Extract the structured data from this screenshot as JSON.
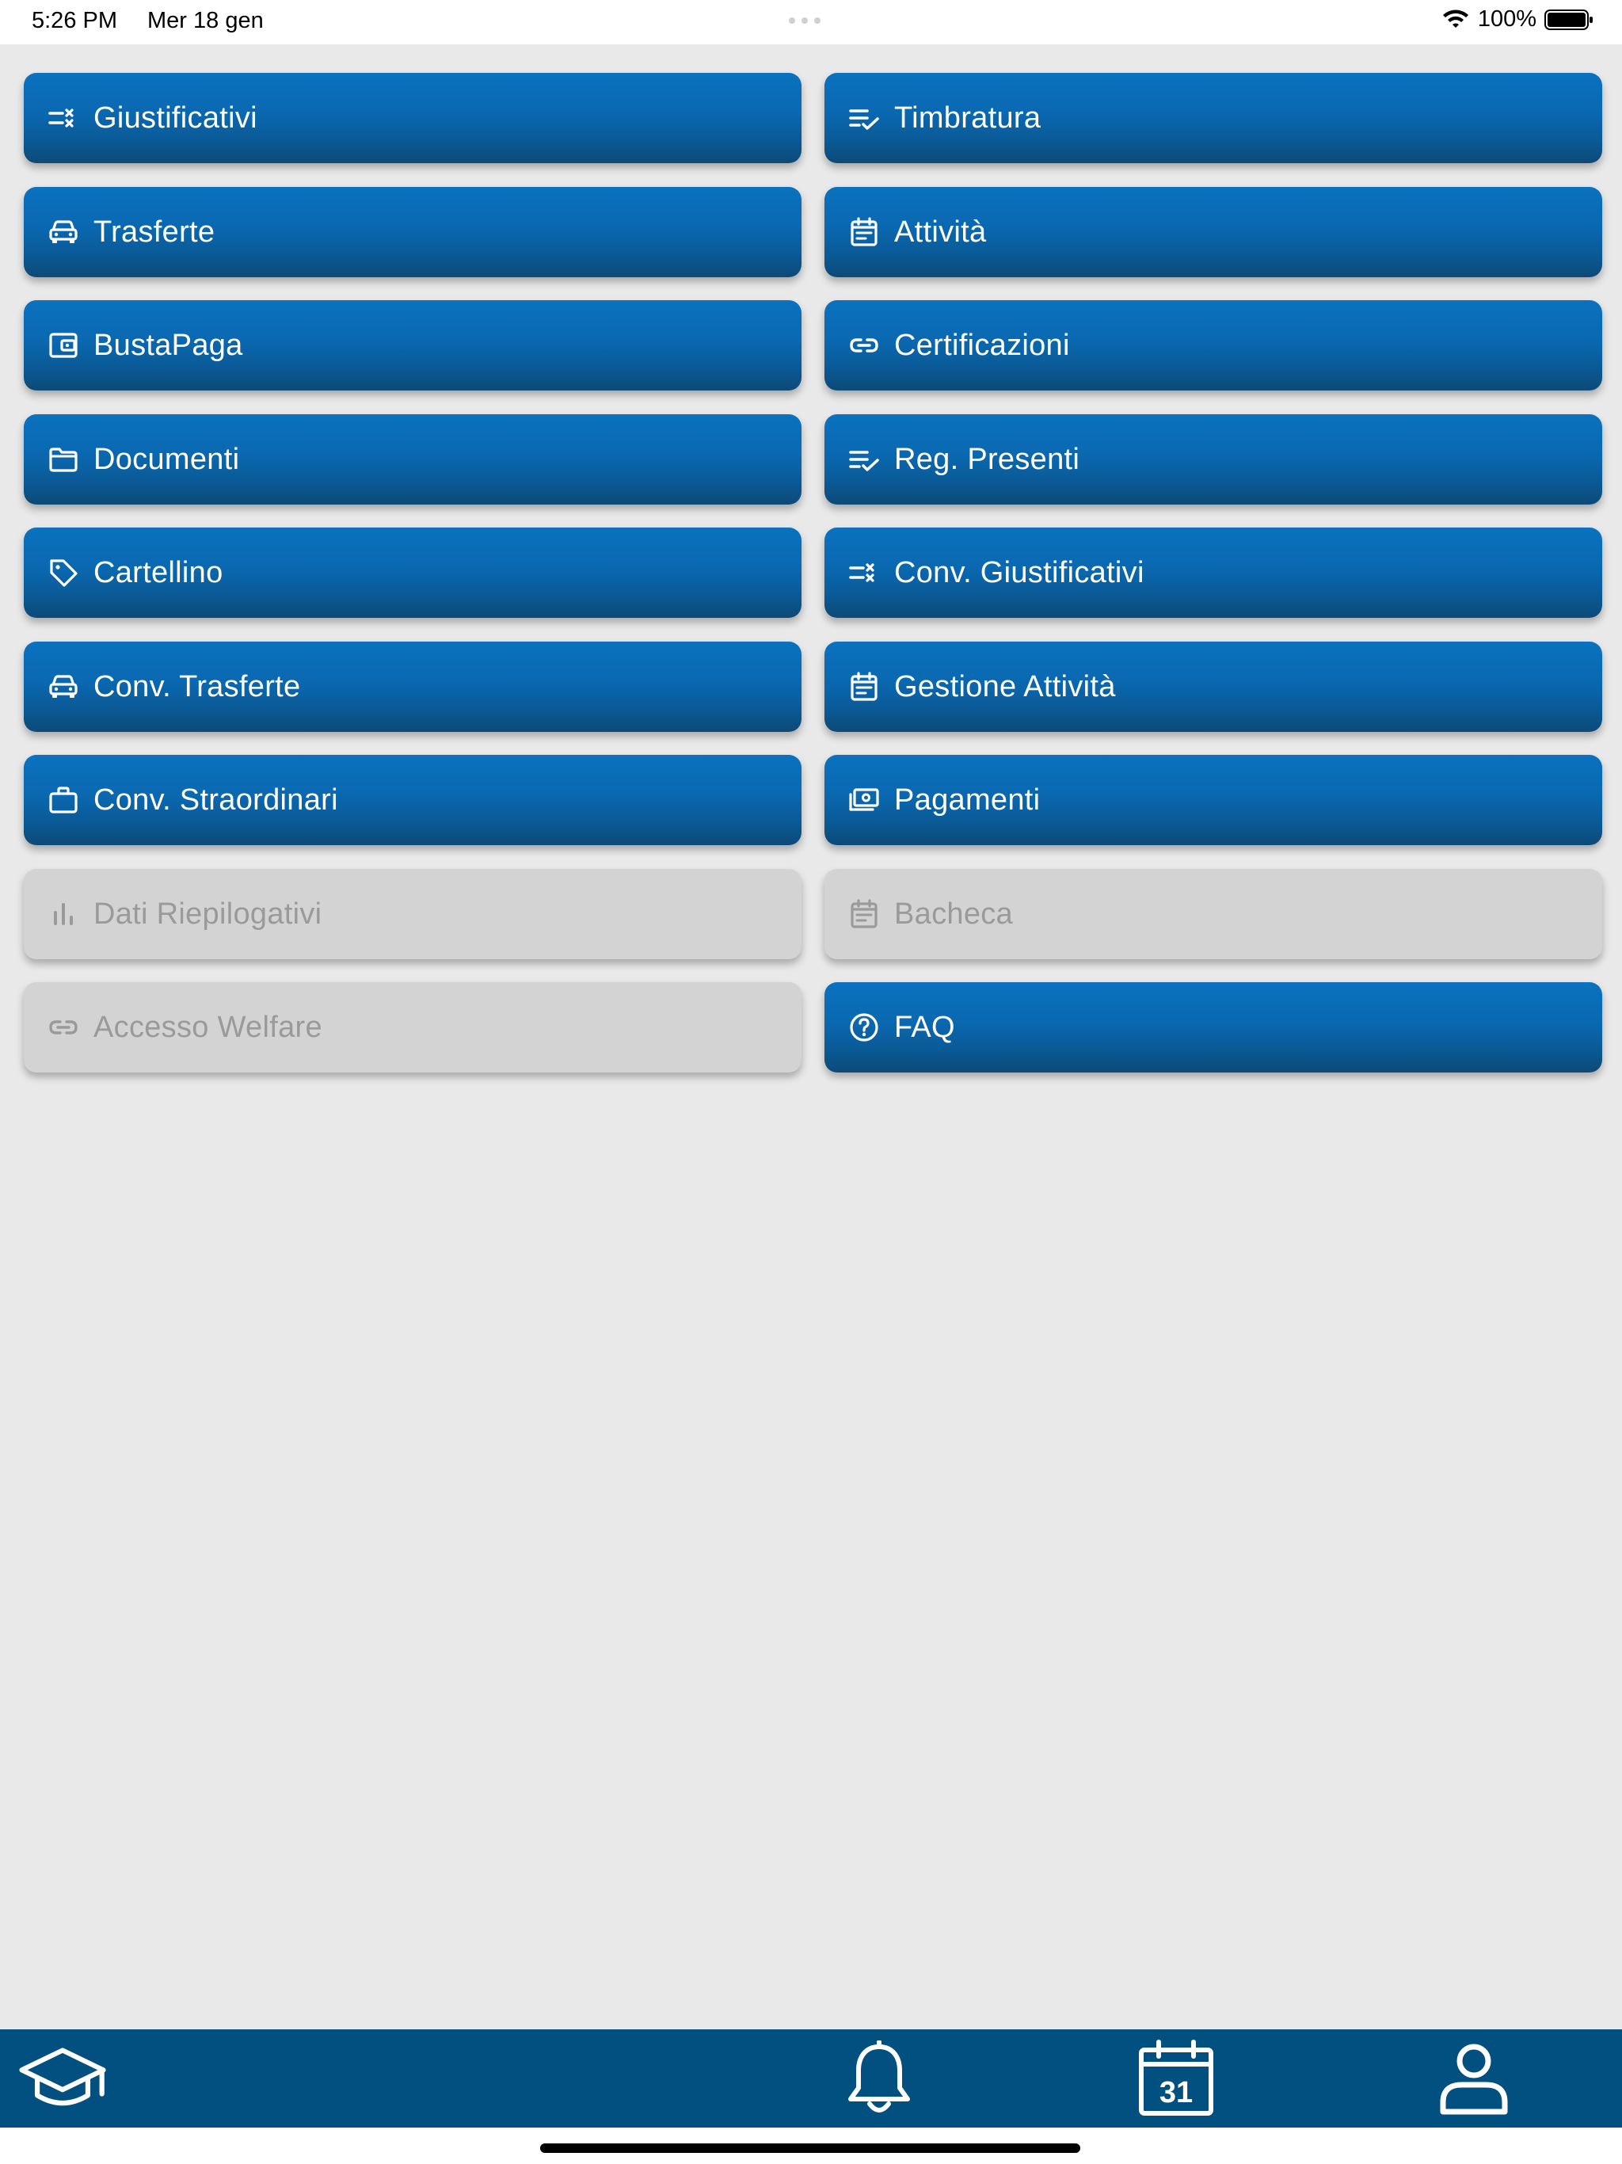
{
  "status_bar": {
    "time": "5:26 PM",
    "date": "Mer 18 gen",
    "battery": "100%"
  },
  "tiles": [
    {
      "label": "Giustificativi",
      "icon": "checklist-x-icon",
      "enabled": true
    },
    {
      "label": "Timbratura",
      "icon": "list-check-icon",
      "enabled": true
    },
    {
      "label": "Trasferte",
      "icon": "car-icon",
      "enabled": true
    },
    {
      "label": "Attività",
      "icon": "calendar-icon",
      "enabled": true
    },
    {
      "label": "BustaPaga",
      "icon": "wallet-icon",
      "enabled": true
    },
    {
      "label": "Certificazioni",
      "icon": "link-icon",
      "enabled": true
    },
    {
      "label": "Documenti",
      "icon": "folder-icon",
      "enabled": true
    },
    {
      "label": "Reg. Presenti",
      "icon": "list-check-icon",
      "enabled": true
    },
    {
      "label": "Cartellino",
      "icon": "tag-icon",
      "enabled": true
    },
    {
      "label": "Conv. Giustificativi",
      "icon": "checklist-x-icon",
      "enabled": true
    },
    {
      "label": "Conv. Trasferte",
      "icon": "car-icon",
      "enabled": true
    },
    {
      "label": "Gestione Attività",
      "icon": "calendar-icon",
      "enabled": true
    },
    {
      "label": "Conv. Straordinari",
      "icon": "briefcase-icon",
      "enabled": true
    },
    {
      "label": "Pagamenti",
      "icon": "money-icon",
      "enabled": true
    },
    {
      "label": "Dati Riepilogativi",
      "icon": "bar-chart-icon",
      "enabled": false
    },
    {
      "label": "Bacheca",
      "icon": "calendar-icon",
      "enabled": false
    },
    {
      "label": "Accesso Welfare",
      "icon": "link-icon",
      "enabled": false
    },
    {
      "label": "FAQ",
      "icon": "help-circle-icon",
      "enabled": true
    }
  ],
  "bottom_nav": {
    "items": [
      {
        "name": "graduation-cap-icon"
      },
      {
        "name": "bell-icon"
      },
      {
        "name": "calendar-31-icon",
        "text": "31"
      },
      {
        "name": "user-icon"
      }
    ]
  },
  "colors": {
    "tile_blue": "#0a68b0",
    "tile_disabled": "#d3d3d3",
    "nav_bar": "#02507f",
    "background": "#e9e9e9"
  }
}
